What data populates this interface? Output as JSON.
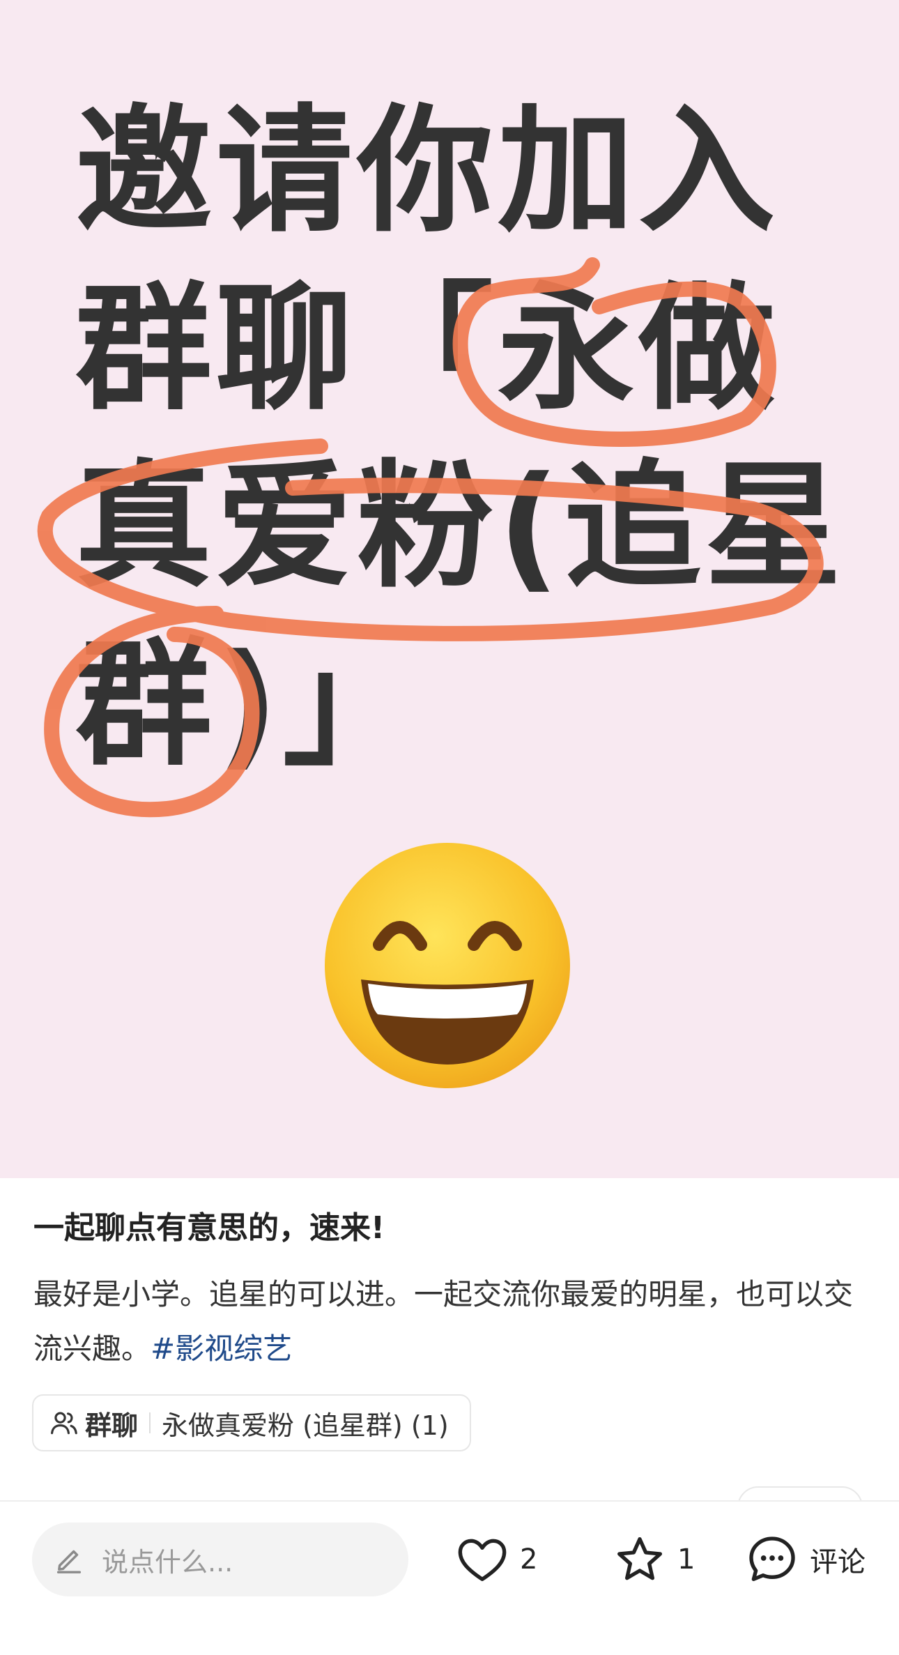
{
  "cover": {
    "lines": [
      "邀请你加入",
      "群聊「永做",
      "真爱粉(追星",
      "群)」"
    ],
    "emoji": "grinning-face-with-smiling-eyes",
    "background_color": "#f8e9f1",
    "highlight_color": "#f07a50"
  },
  "post": {
    "title": "一起聊点有意思的，速来!",
    "body": "最好是小学。追星的可以进。一起交流你最爱的明星，也可以交流兴趣。",
    "hashtag": "#影视综艺"
  },
  "group_chip": {
    "icon": "group-users-icon",
    "label": "群聊",
    "name": "永做真爱粉 (追星群) (1)"
  },
  "bottom_bar": {
    "comment_placeholder": "说点什么...",
    "like_count": "2",
    "favorite_count": "1",
    "comment_label": "评论"
  }
}
